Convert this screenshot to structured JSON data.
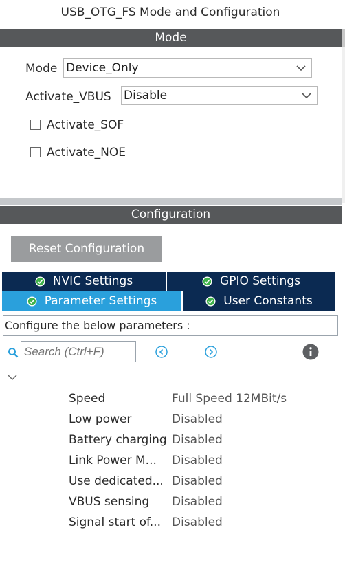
{
  "window": {
    "title": "USB_OTG_FS Mode and Configuration"
  },
  "mode": {
    "header": "Mode",
    "mode_label": "Mode",
    "mode_value": "Device_Only",
    "vbus_label": "Activate_VBUS",
    "vbus_value": "Disable",
    "checkboxes": [
      {
        "label": "Activate_SOF",
        "checked": false
      },
      {
        "label": "Activate_NOE",
        "checked": false
      }
    ]
  },
  "configuration": {
    "header": "Configuration",
    "reset_label": "Reset Configuration",
    "tabs": [
      {
        "label": "NVIC Settings",
        "active": false
      },
      {
        "label": "GPIO Settings",
        "active": false
      },
      {
        "label": "Parameter Settings",
        "active": true
      },
      {
        "label": "User Constants",
        "active": false
      }
    ],
    "description": "Configure the below parameters :",
    "search_placeholder": "Search (Ctrl+F)",
    "params": [
      {
        "name": "Speed",
        "value": "Full Speed 12MBit/s"
      },
      {
        "name": "Low power",
        "value": "Disabled"
      },
      {
        "name": "Battery charging",
        "value": "Disabled"
      },
      {
        "name": "Link Power M...",
        "value": "Disabled"
      },
      {
        "name": "Use dedicated...",
        "value": "Disabled"
      },
      {
        "name": "VBUS sensing",
        "value": "Disabled"
      },
      {
        "name": "Signal start of...",
        "value": "Disabled"
      }
    ]
  },
  "icons": {
    "check": "check-circle-icon",
    "search": "search-icon",
    "prev": "previous-icon",
    "next": "next-icon",
    "info": "info-icon",
    "collapse": "chevron-down-icon"
  },
  "colors": {
    "header_bar": "#56585a",
    "tab_dark": "#0b2a52",
    "tab_active": "#2aa0dc",
    "reset_button": "#9a9c9e",
    "accent": "#2aa0dc",
    "check": "#3fb24a"
  }
}
